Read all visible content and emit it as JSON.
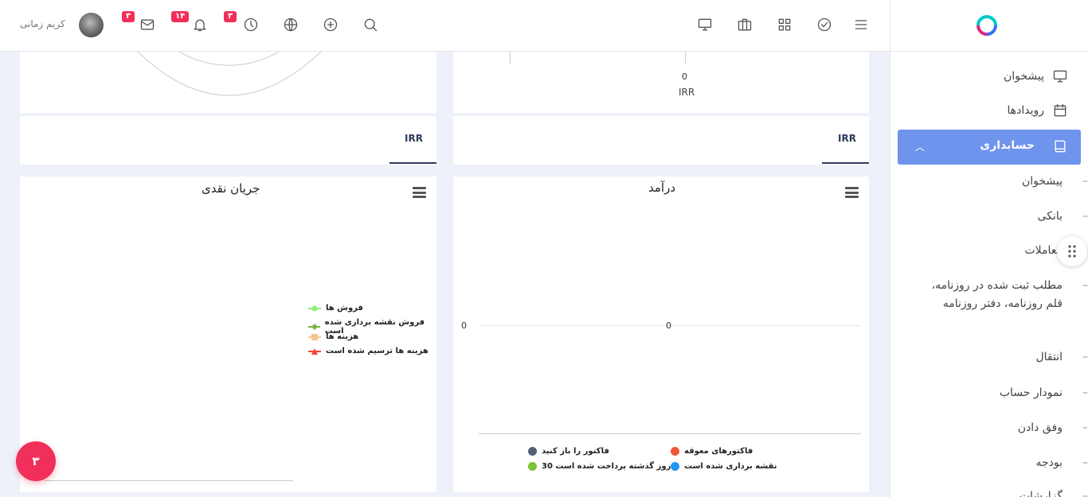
{
  "header": {
    "user_name": "کریم زمانی",
    "badges": {
      "mail": "۳",
      "notifications": "۱۴",
      "clock": "۳"
    }
  },
  "sidebar": {
    "items": [
      {
        "label": "پیشخوان",
        "icon": "monitor-icon"
      },
      {
        "label": "رویدادها",
        "icon": "calendar-icon"
      },
      {
        "label": "حسابداری",
        "icon": "book-icon",
        "active": true
      }
    ],
    "sub_items": [
      {
        "label": "پیشخوان"
      },
      {
        "label": "بانکی"
      },
      {
        "label": "معاملات"
      },
      {
        "label": "مطلب ثبت شده در روزنامه، قلم روزنامه، دفتر روزنامه"
      },
      {
        "label": "انتقال"
      },
      {
        "label": "نمودار حساب"
      },
      {
        "label": "وفق دادن"
      },
      {
        "label": "بودجه"
      },
      {
        "label": "گزارشات"
      }
    ]
  },
  "top_cards": {
    "right_axis_zero": "0",
    "right_axis_currency": "IRR"
  },
  "tabs": {
    "left_tab": "IRR",
    "right_tab": "IRR"
  },
  "charts": {
    "cashflow": {
      "title": "جریان نقدی",
      "legend": [
        {
          "label": "فروش ها",
          "color": "#90ee7e"
        },
        {
          "label": "فروش نقشه برداری شده است",
          "color": "#7cb342"
        },
        {
          "label": "هزینه ها",
          "color": "#f7c38e"
        },
        {
          "label": "هزینه ها ترسیم شده است",
          "color": "#f44336"
        }
      ]
    },
    "income": {
      "title": "درآمد",
      "y_zero": "0",
      "center_value": "0",
      "legend": [
        {
          "label": "فاکتورهای معوقه",
          "color": "#f0573b"
        },
        {
          "label": "فاکتور را باز کنید",
          "color": "#546079"
        },
        {
          "label": "نقشه برداری شده است",
          "color": "#2196f3"
        },
        {
          "label": "روز گذشته پرداخت شده است 30",
          "color": "#7cc233"
        }
      ]
    }
  },
  "chart_data": [
    {
      "type": "line",
      "title": "جریان نقدی",
      "series": [
        {
          "name": "فروش ها",
          "values": []
        },
        {
          "name": "فروش نقشه برداری شده است",
          "values": []
        },
        {
          "name": "هزینه ها",
          "values": []
        },
        {
          "name": "هزینه ها ترسیم شده است",
          "values": []
        }
      ]
    },
    {
      "type": "pie",
      "title": "درآمد",
      "categories": [
        "فاکتورهای معوقه",
        "فاکتور را باز کنید",
        "نقشه برداری شده است",
        "روز گذشته پرداخت شده است 30"
      ],
      "values": [
        0,
        0,
        0,
        0
      ]
    }
  ],
  "fab": {
    "count": "۳"
  }
}
